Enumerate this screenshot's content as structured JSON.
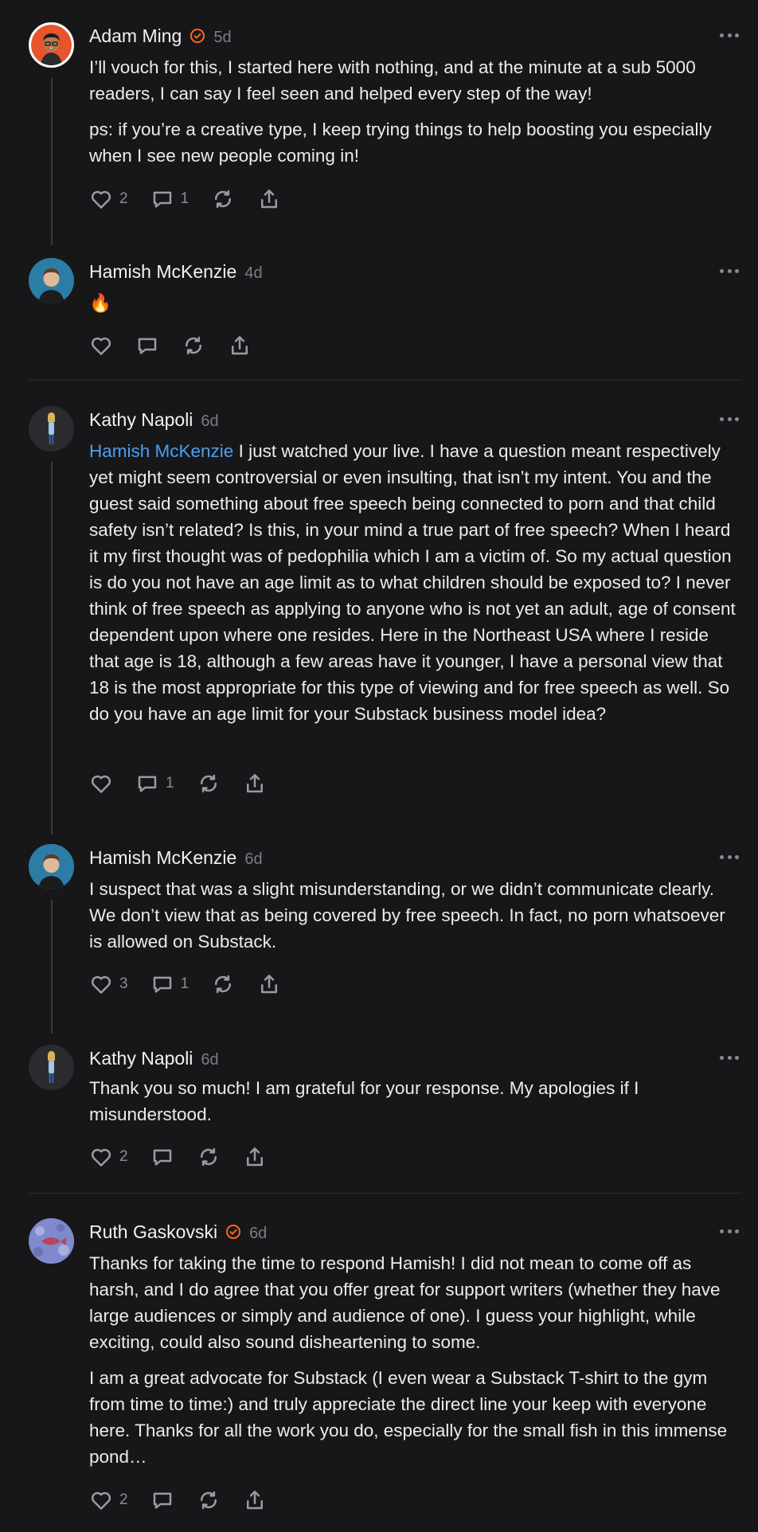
{
  "comments": [
    {
      "author": "Adam Ming",
      "verified": true,
      "time": "5d",
      "paragraphs": [
        "I’ll vouch for this, I started here with nothing, and at the minute at a sub 5000 readers, I can say I feel seen and helped every step of the way!",
        "ps: if you’re a creative type, I keep trying things to help boosting you especially when I see new people coming in!"
      ],
      "likes": "2",
      "replies": "1"
    },
    {
      "author": "Hamish McKenzie",
      "verified": false,
      "time": "4d",
      "paragraphs": [
        "🔥"
      ],
      "likes": "",
      "replies": ""
    },
    {
      "author": "Kathy Napoli",
      "verified": false,
      "time": "6d",
      "mention": "Hamish McKenzie",
      "paragraphs": [
        " I just watched your live. I have a question meant respectively yet might seem controversial or even insulting, that isn’t my intent. You and the guest said something about free speech being connected to porn and that child safety isn’t related? Is this, in your mind a true part of free speech? When I heard it my first thought was of pedophilia which I am a victim of. So my actual question is do you not have an age limit as to what children should be exposed to? I never think of free speech as applying to anyone who is not yet an adult, age of consent dependent upon where one resides. Here in the Northeast USA where I reside that age is 18, although a few areas have it younger, I have a personal view that 18 is the most appropriate for this type of viewing and for free speech as well. So do you have an age limit for your Substack business model idea?"
      ],
      "likes": "",
      "replies": "1"
    },
    {
      "author": "Hamish McKenzie",
      "verified": false,
      "time": "6d",
      "paragraphs": [
        "I suspect that was a slight misunderstanding, or we didn’t communicate clearly. We don’t view that as being covered by free speech. In fact, no porn whatsoever is allowed on Substack."
      ],
      "likes": "3",
      "replies": "1"
    },
    {
      "author": "Kathy Napoli",
      "verified": false,
      "time": "6d",
      "paragraphs": [
        "Thank you so much! I am grateful for your response. My apologies if I misunderstood."
      ],
      "likes": "2",
      "replies": ""
    },
    {
      "author": "Ruth Gaskovski",
      "verified": true,
      "time": "6d",
      "paragraphs": [
        "Thanks for taking the time to respond Hamish! I did not mean to come off as harsh, and I do agree that you offer great for support writers (whether they have large audiences or simply and audience of one). I guess your highlight, while exciting, could also sound disheartening to some.",
        "I am a great advocate for Substack (I even wear a Substack T-shirt to the gym from time to time:) and truly appreciate the direct line your keep with everyone here. Thanks for all the work you do, especially for the small fish in this immense pond…"
      ],
      "likes": "2",
      "replies": ""
    }
  ],
  "icons": {
    "like": "heart-icon",
    "reply": "comment-icon",
    "restack": "restack-icon",
    "share": "share-icon",
    "more": "more-icon",
    "verified": "verified-badge-icon"
  },
  "colors": {
    "background": "#17171a",
    "mention": "#4b9ff0",
    "verified": "#ff6719"
  }
}
